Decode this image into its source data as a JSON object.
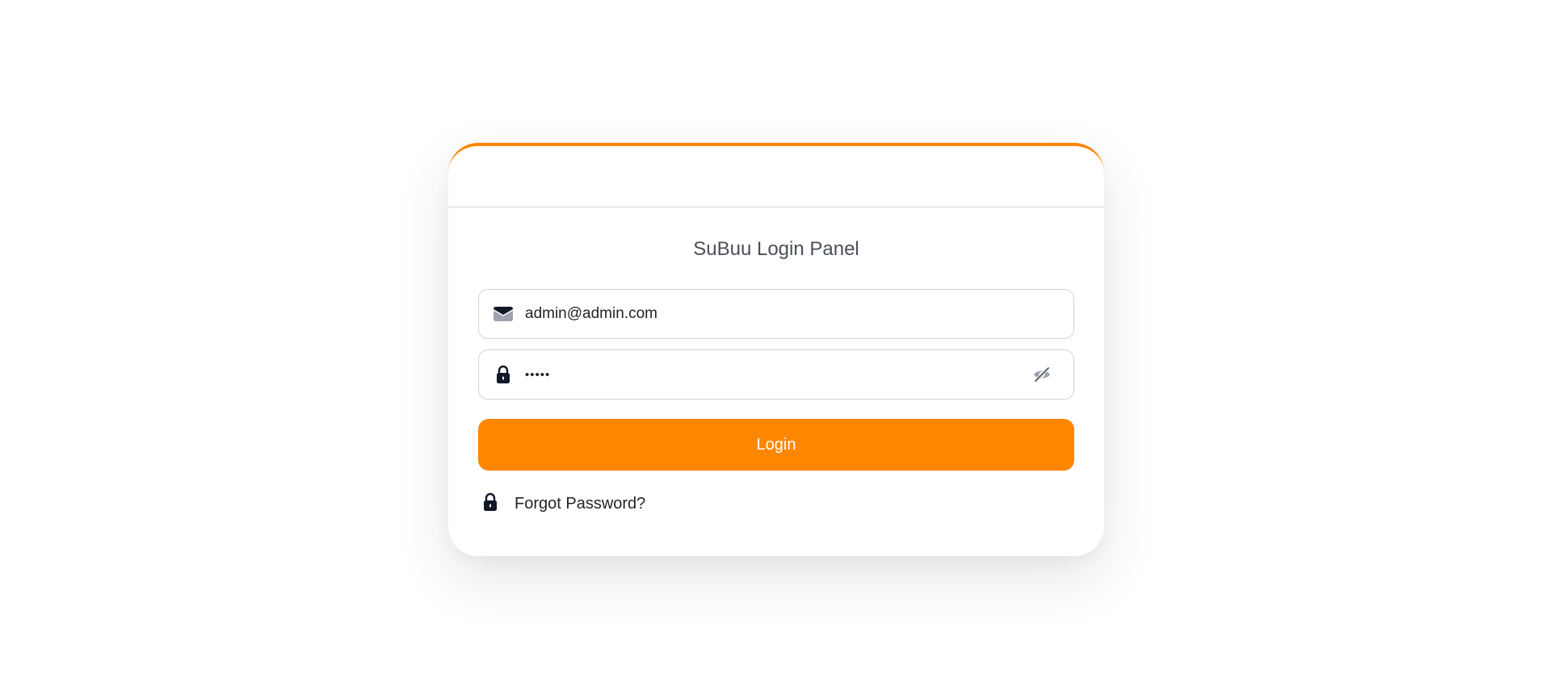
{
  "login_panel": {
    "title": "SuBuu Login Panel",
    "email_value": "admin@admin.com",
    "password_value": "•••••",
    "login_label": "Login",
    "forgot_label": "Forgot Password?",
    "icons": {
      "email": "envelope-icon",
      "password": "lock-icon",
      "toggle_visibility": "eye-off-icon",
      "forgot": "lock-icon"
    },
    "colors": {
      "accent": "#ff8600",
      "title": "#4a4f57",
      "text": "#1f2328"
    }
  }
}
